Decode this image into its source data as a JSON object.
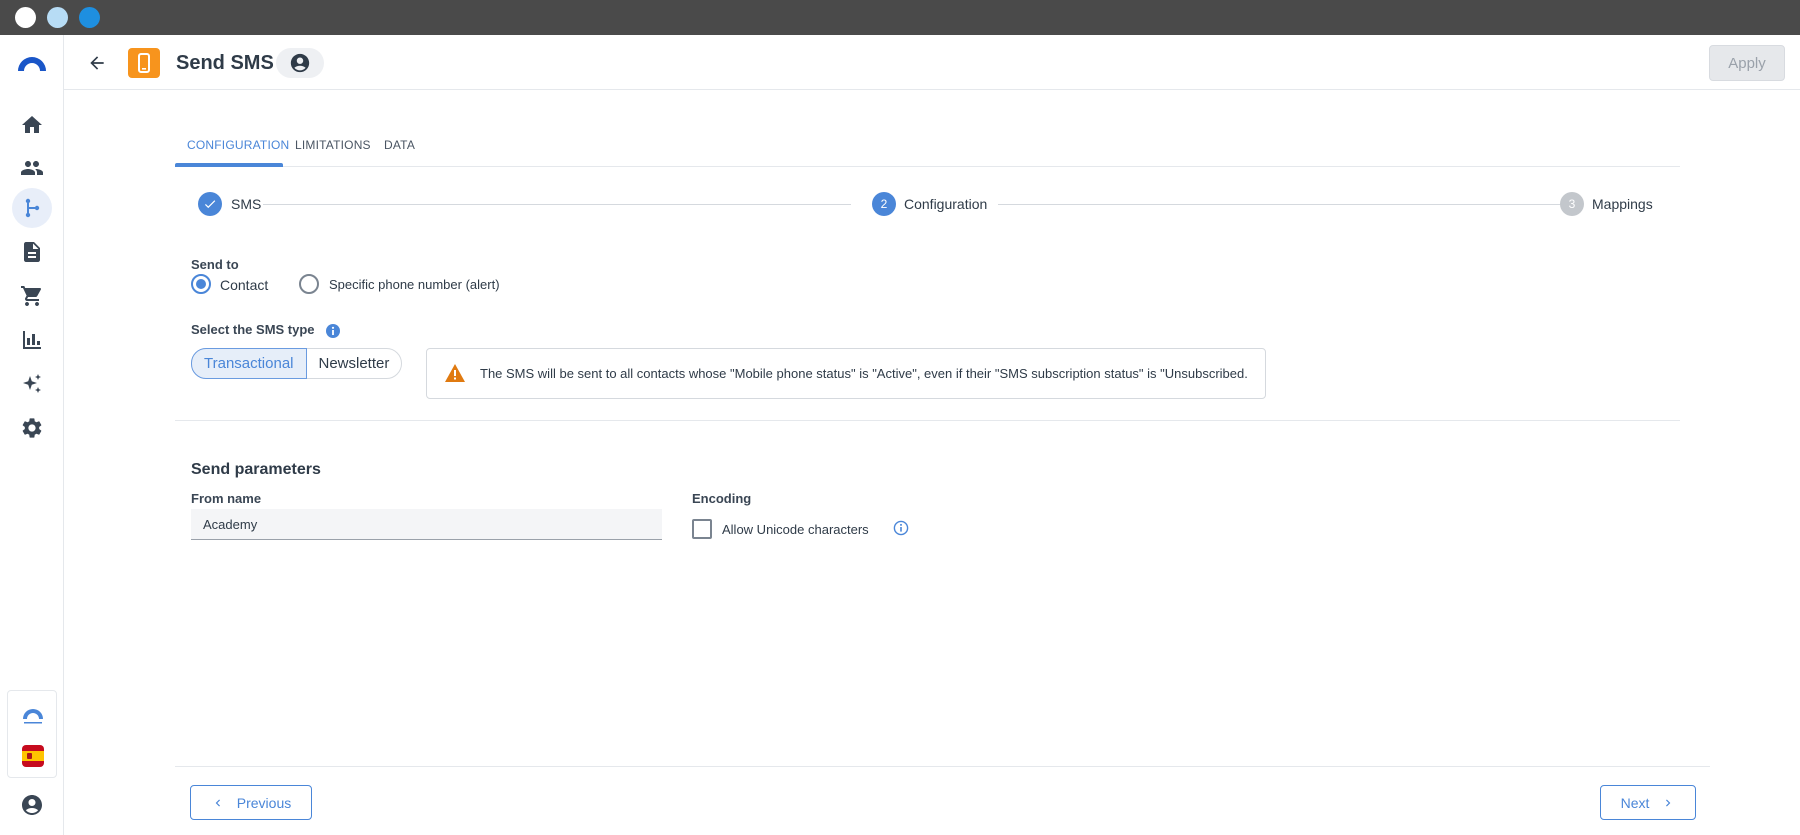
{
  "header": {
    "title": "Send SMS",
    "apply_label": "Apply"
  },
  "tabs": [
    {
      "label": "CONFIGURATION",
      "active": true
    },
    {
      "label": "LIMITATIONS",
      "active": false
    },
    {
      "label": "DATA",
      "active": false
    }
  ],
  "stepper": [
    {
      "number": "1",
      "label": "SMS",
      "state": "done"
    },
    {
      "number": "2",
      "label": "Configuration",
      "state": "active"
    },
    {
      "number": "3",
      "label": "Mappings",
      "state": "pending"
    }
  ],
  "send_to": {
    "label": "Send to",
    "options": [
      {
        "label": "Contact",
        "checked": true
      },
      {
        "label": "Specific phone number (alert)",
        "checked": false
      }
    ]
  },
  "sms_type": {
    "label": "Select the SMS type",
    "options": [
      "Transactional",
      "Newsletter"
    ],
    "selected": "Transactional",
    "warning": "The SMS will be sent to all contacts whose \"Mobile phone status\" is \"Active\", even if their \"SMS subscription status\" is \"Unsubscribed."
  },
  "send_parameters": {
    "title": "Send parameters",
    "from_name_label": "From name",
    "from_name_value": "Academy",
    "encoding_label": "Encoding",
    "unicode_label": "Allow Unicode characters",
    "unicode_checked": false
  },
  "footer": {
    "previous_label": "Previous",
    "next_label": "Next"
  },
  "colors": {
    "accent": "#4a86d8",
    "app_icon": "#f7941d",
    "warning": "#e07a10"
  },
  "sidebar": {
    "items": [
      {
        "icon": "home-icon"
      },
      {
        "icon": "contacts-icon"
      },
      {
        "icon": "workflow-icon",
        "active": true
      },
      {
        "icon": "document-icon"
      },
      {
        "icon": "cart-icon"
      },
      {
        "icon": "bar-chart-icon"
      },
      {
        "icon": "sparkle-icon"
      },
      {
        "icon": "gear-icon"
      }
    ]
  }
}
